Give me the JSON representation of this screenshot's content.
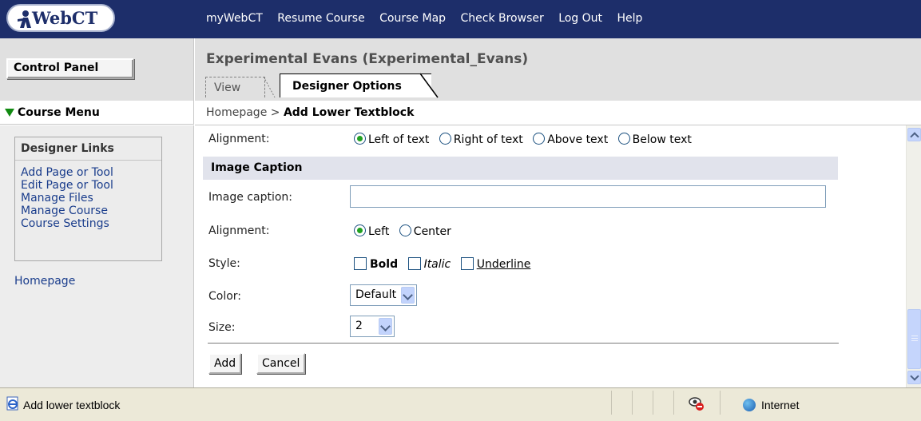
{
  "topbar": {
    "logo_text": "WebCT",
    "nav": [
      "myWebCT",
      "Resume Course",
      "Course Map",
      "Check Browser",
      "Log Out",
      "Help"
    ]
  },
  "control_panel_label": "Control Panel",
  "course": {
    "title": "Experimental Evans  (Experimental_Evans)",
    "tabs": {
      "view": "View",
      "designer_options": "Designer Options"
    }
  },
  "course_menu_label": "Course Menu",
  "breadcrumb": {
    "home": "Homepage",
    "sep": ">",
    "current": "Add Lower Textblock"
  },
  "designer_links": {
    "heading": "Designer Links",
    "items": [
      "Add Page or Tool",
      "Edit Page or Tool",
      "Manage Files",
      "Manage Course",
      "Course Settings"
    ]
  },
  "homepage_link": "Homepage",
  "form": {
    "image_alignment": {
      "label": "Alignment:",
      "options": [
        "Left of text",
        "Right of text",
        "Above text",
        "Below text"
      ],
      "selected": "Left of text"
    },
    "section_heading": "Image Caption",
    "caption": {
      "label": "Image caption:",
      "value": ""
    },
    "caption_alignment": {
      "label": "Alignment:",
      "options": [
        "Left",
        "Center"
      ],
      "selected": "Left"
    },
    "style": {
      "label": "Style:",
      "options": [
        "Bold",
        "Italic",
        "Underline"
      ],
      "checked": []
    },
    "color": {
      "label": "Color:",
      "value": "Default"
    },
    "size": {
      "label": "Size:",
      "value": "2"
    },
    "add_label": "Add",
    "cancel_label": "Cancel"
  },
  "statusbar": {
    "text": "Add lower textblock",
    "zone": "Internet"
  },
  "colors": {
    "topbar": "#1d2e6a",
    "header_gray": "#e0e0e0",
    "section_band": "#e1e3ec",
    "link": "#1a3d8c",
    "radio_dot": "#21a121"
  }
}
